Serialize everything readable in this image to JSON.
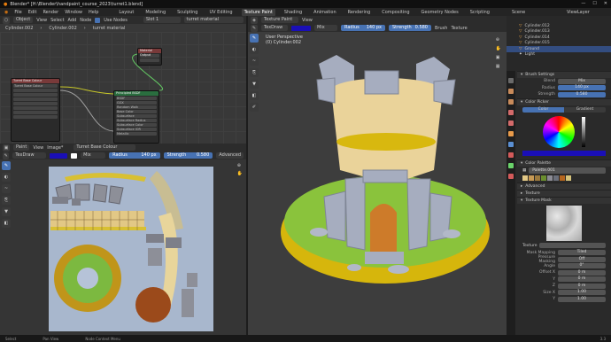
{
  "titlebar": {
    "text": "Blender* [H:\\Blender\\handpaint_course_2023\\turret1.blend]",
    "window_controls": [
      "—",
      "☐",
      "✕"
    ]
  },
  "menubar": {
    "menus": [
      "File",
      "Edit",
      "Render",
      "Window",
      "Help"
    ],
    "workspaces": [
      "Layout",
      "Modeling",
      "Sculpting",
      "UV Editing",
      "Texture Paint",
      "Shading",
      "Animation",
      "Rendering",
      "Compositing",
      "Geometry Nodes",
      "Scripting"
    ],
    "active_workspace": "Texture Paint",
    "scene_label": "Scene",
    "view_layer": "ViewLayer"
  },
  "node_editor": {
    "header": {
      "mode": "Object",
      "view": "View",
      "select": "Select",
      "add": "Add",
      "node": "Node",
      "use_nodes": "Use Nodes",
      "slot": "Slot 1",
      "material": "turret material"
    },
    "breadcrumb": [
      "Cylinder.002",
      "Cylinder.002",
      "turret material"
    ],
    "nodes": {
      "image_texture": "Turret Base Colour",
      "bsdf": "Principled BSDF",
      "output": "Material Output",
      "img_name": "Turret Base Colour"
    },
    "bsdf_rows": [
      "BSDF",
      "GGX",
      "Random Walk",
      "Base Color",
      "Subsurface",
      "Subsurface Radius",
      "Subsurface Color",
      "Subsurface IOR",
      "Metallic",
      "Specular",
      "Specular Tint",
      "Roughness"
    ]
  },
  "image_editor": {
    "header": {
      "paint": "Paint",
      "view": "View",
      "image": "Image*",
      "image_name": "Turret Base Colour"
    },
    "tool_header": {
      "brush": "TexDraw",
      "blend": "Mix",
      "radius_label": "Radius",
      "radius": "140 px",
      "strength_label": "Strength",
      "strength": "0.580",
      "advanced": "Advanced"
    }
  },
  "viewport": {
    "header": {
      "mode": "Texture Paint",
      "view": "View"
    },
    "tool_header": {
      "brush": "TexDraw",
      "blend": "Mix",
      "radius_label": "Radius",
      "radius": "140 px",
      "strength_label": "Strength",
      "strength": "0.580",
      "brush_menu": "Brush",
      "texture_menu": "Texture"
    },
    "overlay_title": "User Perspective",
    "overlay_object": "(0) Cylinder.002"
  },
  "outliner": {
    "items": [
      {
        "name": "Cylinder.012",
        "selected": false
      },
      {
        "name": "Cylinder.013",
        "selected": false
      },
      {
        "name": "Cylinder.014",
        "selected": false
      },
      {
        "name": "Cylinder.015",
        "selected": false
      },
      {
        "name": "Ground",
        "selected": true
      },
      {
        "name": "Light",
        "selected": false
      }
    ]
  },
  "properties": {
    "brush_settings": "Brush Settings",
    "blend_label": "Blend",
    "blend": "Mix",
    "radius_label": "Radius",
    "radius": "140 px",
    "strength_label": "Strength",
    "strength": "0.580",
    "color_picker": "Color Picker",
    "color_tab": "Color",
    "gradient_tab": "Gradient",
    "color_palette": "Color Palette",
    "palette_name": "Palette.001",
    "palette_colors": [
      "#e2c886",
      "#c79a55",
      "#9c7a3d",
      "#6a8e2f",
      "#8c8c95",
      "#6b6f7a",
      "#b5651d",
      "#d6c37a"
    ],
    "primary_color": "#1a0fb6",
    "advanced": "Advanced",
    "texture": "Texture",
    "texture_mask": "Texture Mask",
    "texture_field": "Texture",
    "mask_mapping_label": "Mask Mapping",
    "mask_mapping": "Tiled",
    "pressure_masking_label": "Pressure Masking",
    "pressure_masking": "Off",
    "angle_label": "Angle",
    "angle": "0°",
    "offset_x_label": "Offset X",
    "offset_x": "0 m",
    "offset_y_label": "Y",
    "offset_y": "0 m",
    "offset_z_label": "Z",
    "offset_z": "0 m",
    "size_x_label": "Size X",
    "size_x": "1.00",
    "size_y_label": "Y",
    "size_y": "1.00"
  },
  "statusbar": {
    "select": "Select",
    "pan": "Pan View",
    "context": "Node Context Menu",
    "version": "3.3"
  }
}
